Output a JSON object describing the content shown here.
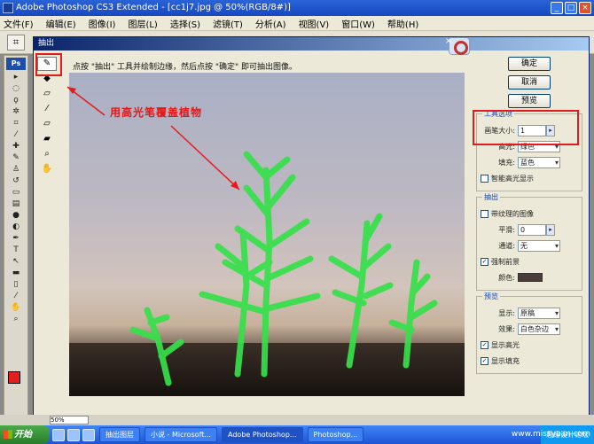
{
  "window": {
    "title": "Adobe Photoshop CS3 Extended - [cc1j7.jpg @ 50%(RGB/8#)]",
    "minimize": "_",
    "maximize": "□",
    "close": "×"
  },
  "menu": [
    "文件(F)",
    "编辑(E)",
    "图像(I)",
    "图层(L)",
    "选择(S)",
    "滤镜(T)",
    "分析(A)",
    "视图(V)",
    "窗口(W)",
    "帮助(H)"
  ],
  "toolbox": {
    "badge": "Ps"
  },
  "dialog": {
    "title": "抽出",
    "close": "×",
    "hint": "点按 \"抽出\" 工具并绘制边缘，然后点按 \"确定\" 即可抽出图像。",
    "annotation": "用高光笔覆盖植物",
    "buttons": {
      "ok": "确定",
      "cancel": "取消",
      "preview": "预览"
    },
    "tool_options": {
      "label": "工具选项",
      "brush_size_label": "画笔大小:",
      "brush_size_value": "1",
      "highlight_label": "高光:",
      "highlight_value": "绿色",
      "fill_label": "填充:",
      "fill_value": "蓝色",
      "smart_highlight": "智能高光显示"
    },
    "extraction": {
      "label": "抽出",
      "textured_image": "带纹理的图像",
      "smooth_label": "平滑:",
      "smooth_value": "0",
      "channel_label": "通道:",
      "channel_value": "无",
      "force_foreground": "强制前景",
      "color_label": "颜色:",
      "color_value": "#4a3c38",
      "force_checked": true
    },
    "preview_group": {
      "label": "预览",
      "show_label": "显示:",
      "show_value": "原稿",
      "view_label": "效果:",
      "view_value": "白色杂边",
      "show_highlight": "显示高光",
      "show_fill": "显示填充"
    }
  },
  "status": {
    "zoom": "50%"
  },
  "taskbar": {
    "start": "开始",
    "tasks": [
      "抽出图层",
      "小说 - Microsoft...",
      "Adobe Photoshop...",
      "Photoshop..."
    ],
    "tray": "思缘设计论坛",
    "watermark": "www.missyuan.com"
  }
}
